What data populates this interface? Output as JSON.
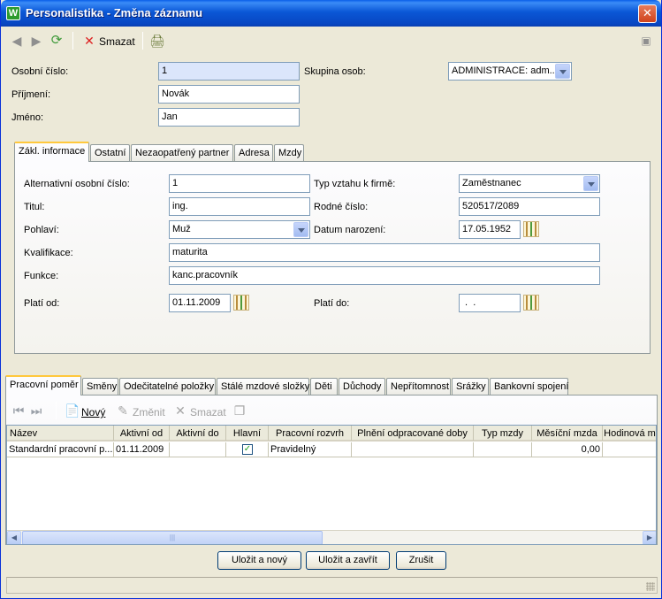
{
  "window": {
    "title": "Personalistika - Změna záznamu",
    "app_icon_letter": "W"
  },
  "toolbar": {
    "delete_label": "Smazat"
  },
  "header_form": {
    "personal_number_label": "Osobní číslo:",
    "personal_number_value": "1",
    "surname_label": "Příjmení:",
    "surname_value": "Novák",
    "name_label": "Jméno:",
    "name_value": "Jan",
    "group_label": "Skupina osob:",
    "group_value": "ADMINISTRACE: adm..."
  },
  "main_tabs": [
    "Zákl. informace",
    "Ostatní",
    "Nezaopatřený partner",
    "Adresa",
    "Mzdy"
  ],
  "basic_info": {
    "alt_number_label": "Alternativní osobní číslo:",
    "alt_number_value": "1",
    "title_label": "Titul:",
    "title_value": "ing.",
    "gender_label": "Pohlaví:",
    "gender_value": "Muž",
    "qualification_label": "Kvalifikace:",
    "qualification_value": "maturita",
    "function_label": "Funkce:",
    "function_value": "kanc.pracovník",
    "valid_from_label": "Platí od:",
    "valid_from_value": "01.11.2009",
    "relation_label": "Typ vztahu k firmě:",
    "relation_value": "Zaměstnanec",
    "birth_number_label": "Rodné číslo:",
    "birth_number_value": "520517/2089",
    "birth_date_label": "Datum narození:",
    "birth_date_value": "17.05.1952",
    "valid_to_label": "Platí do:",
    "valid_to_value": " .  . "
  },
  "lower_tabs": [
    "Pracovní poměr",
    "Směny",
    "Odečitatelné položky",
    "Stálé mzdové složky",
    "Děti",
    "Důchody",
    "Nepřítomnost",
    "Srážky",
    "Bankovní spojení"
  ],
  "grid_toolbar": {
    "new_label": "Nový",
    "change_label": "Změnit",
    "delete_label": "Smazat"
  },
  "grid": {
    "columns": [
      "Název",
      "Aktivní od",
      "Aktivní do",
      "Hlavní",
      "Pracovní rozvrh",
      "Plnění odpracované doby",
      "Typ mzdy",
      "Měsíční mzda",
      "Hodinová m"
    ],
    "rows": [
      {
        "name": "Standardní pracovní p...",
        "active_from": "01.11.2009",
        "active_to": "",
        "main_check": "✓",
        "schedule": "Pravidelný",
        "fulfillment": "",
        "wage_type": "",
        "monthly_wage": "0,00",
        "hourly": ""
      }
    ]
  },
  "buttons": {
    "save_new": "Uložit a nový",
    "save_close": "Uložit a zavřít",
    "cancel": "Zrušit"
  }
}
